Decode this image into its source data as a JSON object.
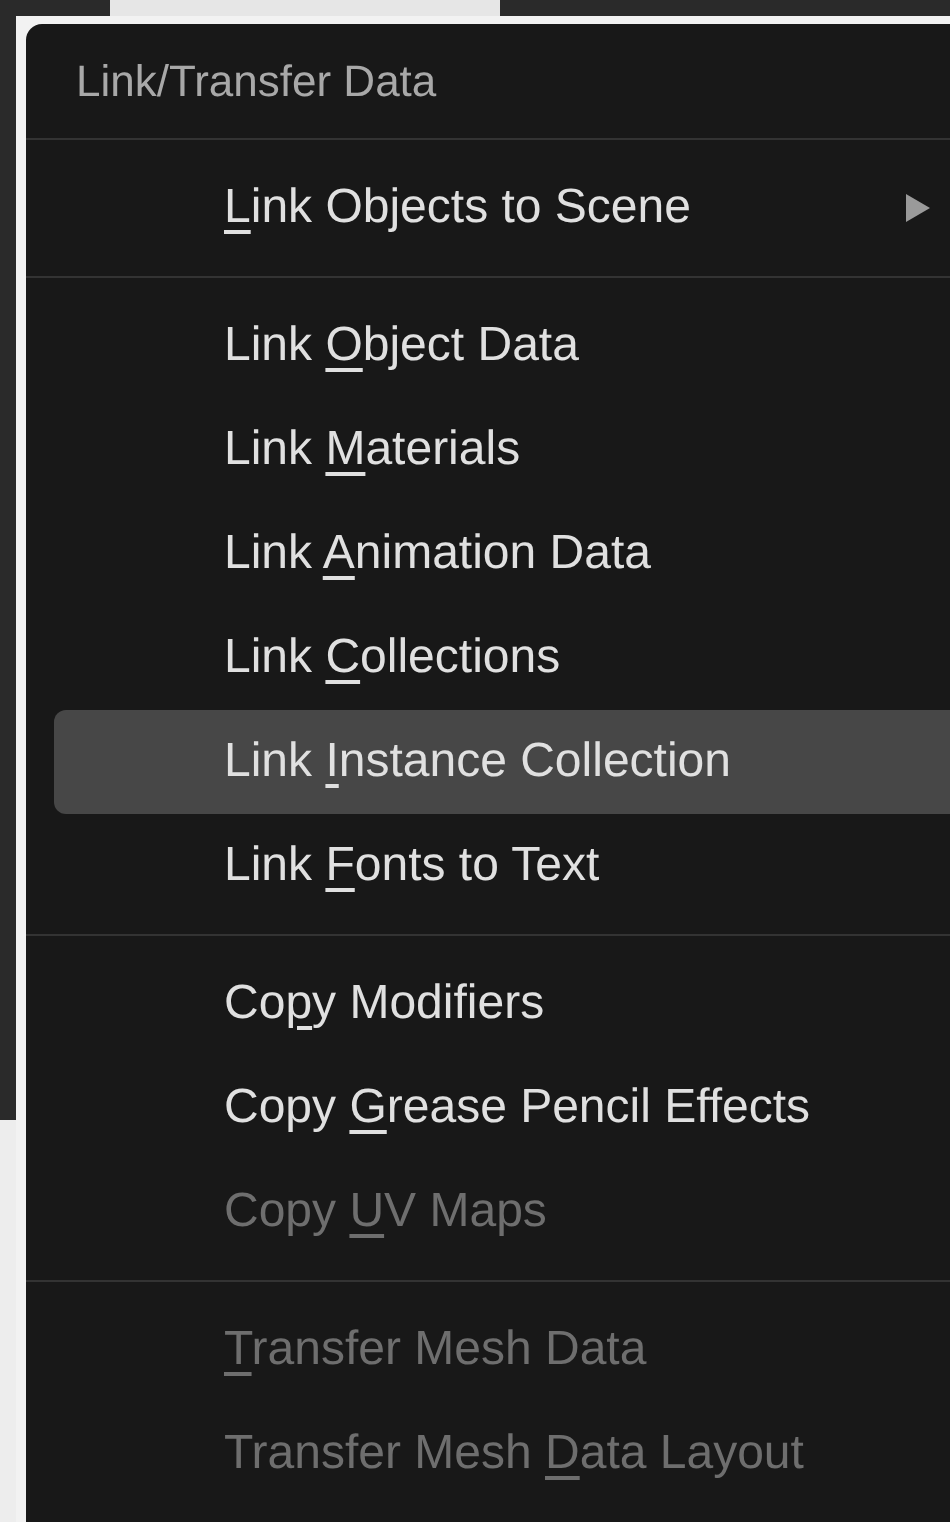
{
  "menu": {
    "title": "Link/Transfer Data",
    "sections": [
      {
        "items": [
          {
            "key": "L",
            "post": "ink Objects to Scene",
            "selected": false,
            "disabled": false,
            "submenu": true
          }
        ]
      },
      {
        "items": [
          {
            "pre": "Link ",
            "key": "O",
            "post": "bject Data",
            "selected": false,
            "disabled": false,
            "submenu": false
          },
          {
            "pre": "Link ",
            "key": "M",
            "post": "aterials",
            "selected": false,
            "disabled": false,
            "submenu": false
          },
          {
            "pre": "Link ",
            "key": "A",
            "post": "nimation Data",
            "selected": false,
            "disabled": false,
            "submenu": false
          },
          {
            "pre": "Link ",
            "key": "C",
            "post": "ollections",
            "selected": false,
            "disabled": false,
            "submenu": false
          },
          {
            "pre": "Link ",
            "key": "I",
            "post": "nstance Collection",
            "selected": true,
            "disabled": false,
            "submenu": false
          },
          {
            "pre": "Link ",
            "key": "F",
            "post": "onts to Text",
            "selected": false,
            "disabled": false,
            "submenu": false
          }
        ]
      },
      {
        "items": [
          {
            "pre": "Co",
            "key": "p",
            "post": "y Modifiers",
            "selected": false,
            "disabled": false,
            "submenu": false
          },
          {
            "pre": "Copy ",
            "key": "G",
            "post": "rease Pencil Effects",
            "selected": false,
            "disabled": false,
            "submenu": false
          },
          {
            "pre": "Copy ",
            "key": "U",
            "post": "V Maps",
            "selected": false,
            "disabled": true,
            "submenu": false
          }
        ]
      },
      {
        "items": [
          {
            "key": "T",
            "post": "ransfer Mesh Data",
            "selected": false,
            "disabled": true,
            "submenu": false
          },
          {
            "pre": "Transfer Mesh ",
            "key": "D",
            "post": "ata Layout",
            "selected": false,
            "disabled": true,
            "submenu": false
          }
        ]
      }
    ]
  }
}
